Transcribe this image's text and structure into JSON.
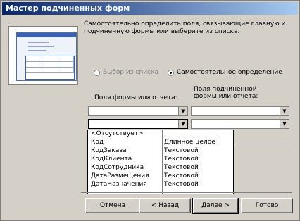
{
  "window": {
    "title": "Мастер подчиненных форм"
  },
  "description": "Самостоятельно определить поля, связывающие главную и подчиненную формы или выберите из списка.",
  "radio_options": [
    {
      "label": "Выбор из списка",
      "selected": false,
      "disabled": true
    },
    {
      "label": "Самостоятельное определение",
      "selected": true,
      "disabled": false
    }
  ],
  "labels": {
    "form_fields": "Поля формы или отчета:",
    "subform_fields": "Поля подчиненной формы или отчета:"
  },
  "dropdown": {
    "items": [
      {
        "name": "<Отсутствует>",
        "type": ""
      },
      {
        "name": "Код",
        "type": "Длинное целое"
      },
      {
        "name": "КодЗаказа",
        "type": "Текстовой"
      },
      {
        "name": "КодКлиента",
        "type": "Текстовой"
      },
      {
        "name": "КодСотрудника",
        "type": "Текстовой"
      },
      {
        "name": "ДатаРазмещения",
        "type": "Текстовой"
      },
      {
        "name": "ДатаНазначения",
        "type": "Текстовой"
      }
    ]
  },
  "buttons": {
    "cancel": "Отмена",
    "back": "< Назад",
    "next": "Далее >",
    "finish": "Готово"
  }
}
